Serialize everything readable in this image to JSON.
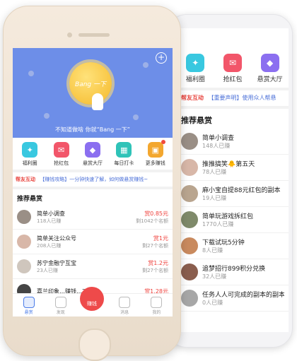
{
  "banner": {
    "coin_text": "Bang 一下",
    "caption": "不知道做啥 你就“Bang 一下”"
  },
  "grid": [
    {
      "label": "福利圈",
      "icon": "gift-icon",
      "color": "#39c8e0"
    },
    {
      "label": "抢红包",
      "icon": "red-packet-icon",
      "color": "#f2566a"
    },
    {
      "label": "悬赏大厅",
      "icon": "bag-icon",
      "color": "#8b6ff0"
    },
    {
      "label": "每日打卡",
      "icon": "calendar-icon",
      "color": "#2fc3b8"
    },
    {
      "label": "更多赚钱",
      "icon": "more-icon",
      "color": "#f3a72f"
    }
  ],
  "ticker": {
    "tag": "帮友互动",
    "message": "【赚钱攻略】一分钟快速了解，如何做悬赏赚钱~"
  },
  "section_title": "推荐悬赏",
  "tasks": [
    {
      "title": "简单小调查",
      "sub": "118人已赚",
      "reward": "赏0.85元",
      "remain": "剩1042个名额"
    },
    {
      "title": "简单关注公众号",
      "sub": "208人已赚",
      "reward": "赏1元",
      "remain": "剩27个名额"
    },
    {
      "title": "苏宁金融宁互宝",
      "sub": "23人已赚",
      "reward": "赏1.2元",
      "remain": "剩27个名额"
    },
    {
      "title": "嘉兰印象…赚钱…2元",
      "sub": "",
      "reward": "赏1.28元",
      "remain": ""
    }
  ],
  "tabbar": [
    {
      "label": "悬赏",
      "active": true
    },
    {
      "label": "发现",
      "active": false
    },
    {
      "label": "消息",
      "active": false
    },
    {
      "label": "我的",
      "active": false
    }
  ],
  "earn_button": "赚钱",
  "back_screen": {
    "grid": [
      {
        "label": "福利圈",
        "icon": "gift-icon",
        "color": "#39c8e0"
      },
      {
        "label": "抢红包",
        "icon": "red-packet-icon",
        "color": "#f2566a"
      },
      {
        "label": "悬赏大厅",
        "icon": "bag-icon",
        "color": "#8b6ff0"
      }
    ],
    "ticker": {
      "tag": "帮友互动",
      "message": "【重要声明】使用众人帮悬"
    },
    "section_title": "推荐悬赏",
    "tasks": [
      {
        "title": "简单小调查",
        "sub": "148人已赚"
      },
      {
        "title": "推推搞笑🐥第五天",
        "sub": "78人已赚"
      },
      {
        "title": "麻小宝自提88元红包的副本",
        "sub": "19人已赚"
      },
      {
        "title": "简单玩游戏拆红包",
        "sub": "1770人已赚"
      },
      {
        "title": "下载试玩5分钟",
        "sub": "8人已赚"
      },
      {
        "title": "追梦招行899积分兑换",
        "sub": "32人已赚"
      },
      {
        "title": "任务人人可完成的副本的副本",
        "sub": "0人已赚"
      }
    ]
  }
}
